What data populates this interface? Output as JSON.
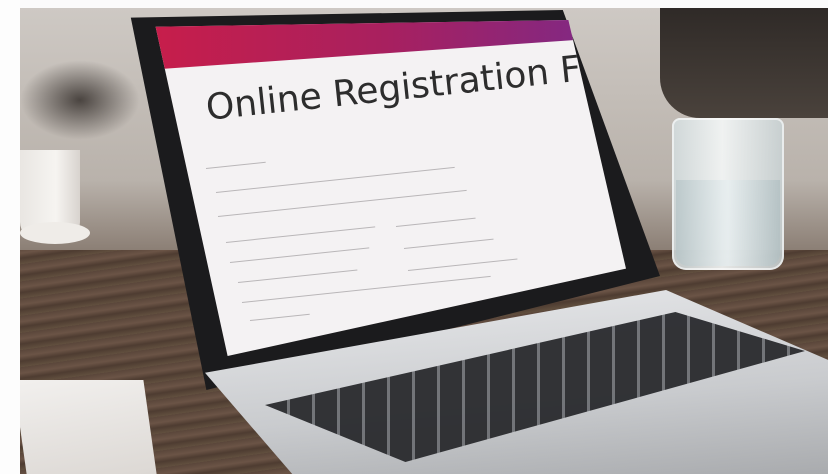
{
  "scene": {
    "screen_title": "Online Registration Form",
    "colors": {
      "header_gradient_start": "#c81e4a",
      "header_gradient_end": "#7a2a8a",
      "screen_background": "#f4f2f3",
      "title_text": "#2d2d2d"
    },
    "icons": {
      "laptop": "laptop-icon",
      "glass": "glass-icon",
      "cup": "cup-icon"
    }
  }
}
